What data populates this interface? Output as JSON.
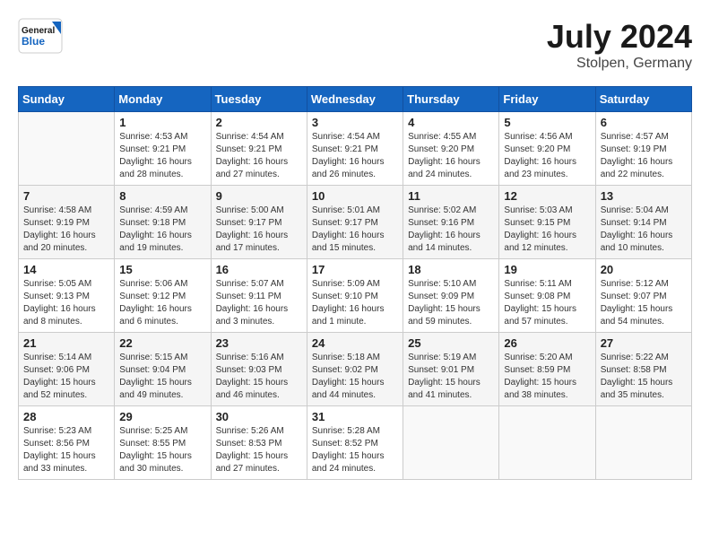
{
  "header": {
    "logo_line1": "General",
    "logo_line2": "Blue",
    "month_year": "July 2024",
    "location": "Stolpen, Germany"
  },
  "columns": [
    "Sunday",
    "Monday",
    "Tuesday",
    "Wednesday",
    "Thursday",
    "Friday",
    "Saturday"
  ],
  "weeks": [
    [
      {
        "day": "",
        "sunrise": "",
        "sunset": "",
        "daylight": ""
      },
      {
        "day": "1",
        "sunrise": "Sunrise: 4:53 AM",
        "sunset": "Sunset: 9:21 PM",
        "daylight": "Daylight: 16 hours and 28 minutes."
      },
      {
        "day": "2",
        "sunrise": "Sunrise: 4:54 AM",
        "sunset": "Sunset: 9:21 PM",
        "daylight": "Daylight: 16 hours and 27 minutes."
      },
      {
        "day": "3",
        "sunrise": "Sunrise: 4:54 AM",
        "sunset": "Sunset: 9:21 PM",
        "daylight": "Daylight: 16 hours and 26 minutes."
      },
      {
        "day": "4",
        "sunrise": "Sunrise: 4:55 AM",
        "sunset": "Sunset: 9:20 PM",
        "daylight": "Daylight: 16 hours and 24 minutes."
      },
      {
        "day": "5",
        "sunrise": "Sunrise: 4:56 AM",
        "sunset": "Sunset: 9:20 PM",
        "daylight": "Daylight: 16 hours and 23 minutes."
      },
      {
        "day": "6",
        "sunrise": "Sunrise: 4:57 AM",
        "sunset": "Sunset: 9:19 PM",
        "daylight": "Daylight: 16 hours and 22 minutes."
      }
    ],
    [
      {
        "day": "7",
        "sunrise": "Sunrise: 4:58 AM",
        "sunset": "Sunset: 9:19 PM",
        "daylight": "Daylight: 16 hours and 20 minutes."
      },
      {
        "day": "8",
        "sunrise": "Sunrise: 4:59 AM",
        "sunset": "Sunset: 9:18 PM",
        "daylight": "Daylight: 16 hours and 19 minutes."
      },
      {
        "day": "9",
        "sunrise": "Sunrise: 5:00 AM",
        "sunset": "Sunset: 9:17 PM",
        "daylight": "Daylight: 16 hours and 17 minutes."
      },
      {
        "day": "10",
        "sunrise": "Sunrise: 5:01 AM",
        "sunset": "Sunset: 9:17 PM",
        "daylight": "Daylight: 16 hours and 15 minutes."
      },
      {
        "day": "11",
        "sunrise": "Sunrise: 5:02 AM",
        "sunset": "Sunset: 9:16 PM",
        "daylight": "Daylight: 16 hours and 14 minutes."
      },
      {
        "day": "12",
        "sunrise": "Sunrise: 5:03 AM",
        "sunset": "Sunset: 9:15 PM",
        "daylight": "Daylight: 16 hours and 12 minutes."
      },
      {
        "day": "13",
        "sunrise": "Sunrise: 5:04 AM",
        "sunset": "Sunset: 9:14 PM",
        "daylight": "Daylight: 16 hours and 10 minutes."
      }
    ],
    [
      {
        "day": "14",
        "sunrise": "Sunrise: 5:05 AM",
        "sunset": "Sunset: 9:13 PM",
        "daylight": "Daylight: 16 hours and 8 minutes."
      },
      {
        "day": "15",
        "sunrise": "Sunrise: 5:06 AM",
        "sunset": "Sunset: 9:12 PM",
        "daylight": "Daylight: 16 hours and 6 minutes."
      },
      {
        "day": "16",
        "sunrise": "Sunrise: 5:07 AM",
        "sunset": "Sunset: 9:11 PM",
        "daylight": "Daylight: 16 hours and 3 minutes."
      },
      {
        "day": "17",
        "sunrise": "Sunrise: 5:09 AM",
        "sunset": "Sunset: 9:10 PM",
        "daylight": "Daylight: 16 hours and 1 minute."
      },
      {
        "day": "18",
        "sunrise": "Sunrise: 5:10 AM",
        "sunset": "Sunset: 9:09 PM",
        "daylight": "Daylight: 15 hours and 59 minutes."
      },
      {
        "day": "19",
        "sunrise": "Sunrise: 5:11 AM",
        "sunset": "Sunset: 9:08 PM",
        "daylight": "Daylight: 15 hours and 57 minutes."
      },
      {
        "day": "20",
        "sunrise": "Sunrise: 5:12 AM",
        "sunset": "Sunset: 9:07 PM",
        "daylight": "Daylight: 15 hours and 54 minutes."
      }
    ],
    [
      {
        "day": "21",
        "sunrise": "Sunrise: 5:14 AM",
        "sunset": "Sunset: 9:06 PM",
        "daylight": "Daylight: 15 hours and 52 minutes."
      },
      {
        "day": "22",
        "sunrise": "Sunrise: 5:15 AM",
        "sunset": "Sunset: 9:04 PM",
        "daylight": "Daylight: 15 hours and 49 minutes."
      },
      {
        "day": "23",
        "sunrise": "Sunrise: 5:16 AM",
        "sunset": "Sunset: 9:03 PM",
        "daylight": "Daylight: 15 hours and 46 minutes."
      },
      {
        "day": "24",
        "sunrise": "Sunrise: 5:18 AM",
        "sunset": "Sunset: 9:02 PM",
        "daylight": "Daylight: 15 hours and 44 minutes."
      },
      {
        "day": "25",
        "sunrise": "Sunrise: 5:19 AM",
        "sunset": "Sunset: 9:01 PM",
        "daylight": "Daylight: 15 hours and 41 minutes."
      },
      {
        "day": "26",
        "sunrise": "Sunrise: 5:20 AM",
        "sunset": "Sunset: 8:59 PM",
        "daylight": "Daylight: 15 hours and 38 minutes."
      },
      {
        "day": "27",
        "sunrise": "Sunrise: 5:22 AM",
        "sunset": "Sunset: 8:58 PM",
        "daylight": "Daylight: 15 hours and 35 minutes."
      }
    ],
    [
      {
        "day": "28",
        "sunrise": "Sunrise: 5:23 AM",
        "sunset": "Sunset: 8:56 PM",
        "daylight": "Daylight: 15 hours and 33 minutes."
      },
      {
        "day": "29",
        "sunrise": "Sunrise: 5:25 AM",
        "sunset": "Sunset: 8:55 PM",
        "daylight": "Daylight: 15 hours and 30 minutes."
      },
      {
        "day": "30",
        "sunrise": "Sunrise: 5:26 AM",
        "sunset": "Sunset: 8:53 PM",
        "daylight": "Daylight: 15 hours and 27 minutes."
      },
      {
        "day": "31",
        "sunrise": "Sunrise: 5:28 AM",
        "sunset": "Sunset: 8:52 PM",
        "daylight": "Daylight: 15 hours and 24 minutes."
      },
      {
        "day": "",
        "sunrise": "",
        "sunset": "",
        "daylight": ""
      },
      {
        "day": "",
        "sunrise": "",
        "sunset": "",
        "daylight": ""
      },
      {
        "day": "",
        "sunrise": "",
        "sunset": "",
        "daylight": ""
      }
    ]
  ]
}
